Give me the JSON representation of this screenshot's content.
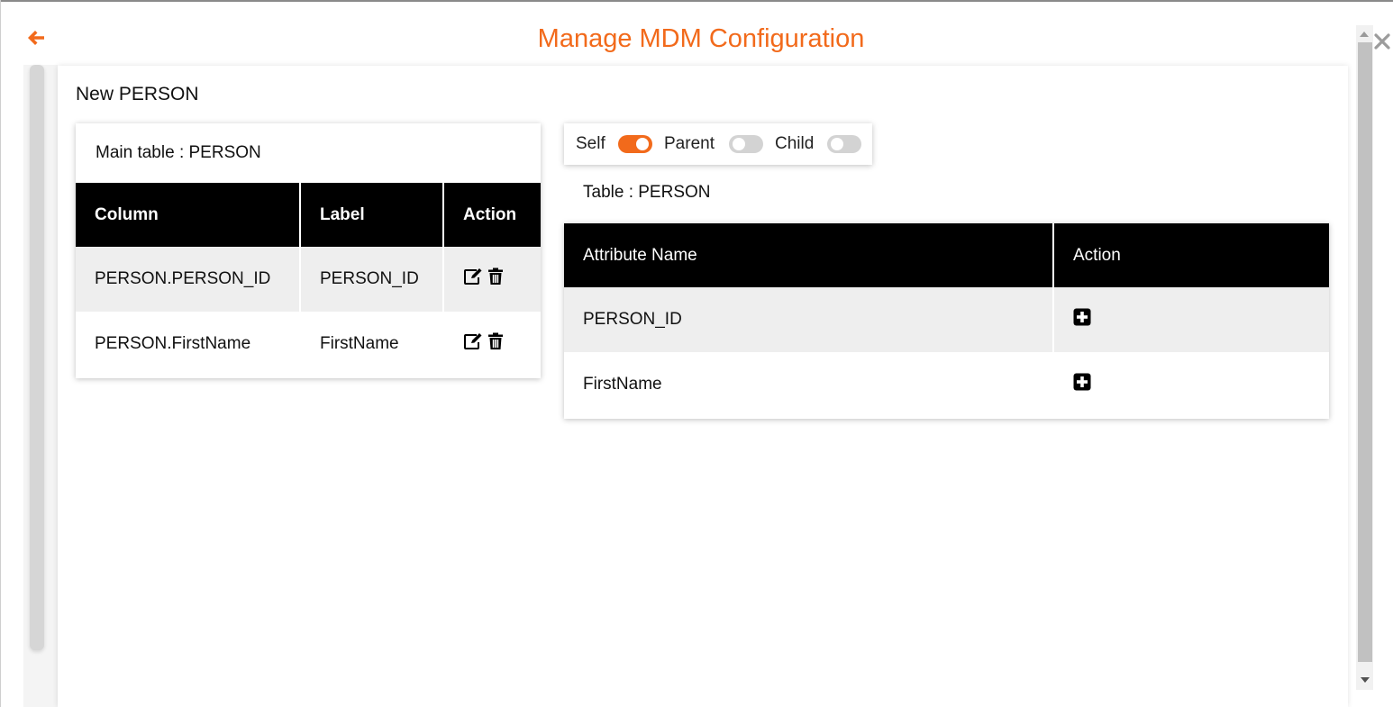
{
  "header": {
    "title": "Manage MDM Configuration",
    "back_icon": "arrow-left-icon",
    "close_icon": "close-icon",
    "accent_color": "#f26a1b"
  },
  "card": {
    "title": "New PERSON"
  },
  "main_table": {
    "label": "Main table : PERSON",
    "columns": [
      "Column",
      "Label",
      "Action"
    ],
    "rows": [
      {
        "column": "PERSON.PERSON_ID",
        "label": "PERSON_ID",
        "actions": [
          "edit-icon",
          "trash-icon"
        ]
      },
      {
        "column": "PERSON.FirstName",
        "label": "FirstName",
        "actions": [
          "edit-icon",
          "trash-icon"
        ]
      }
    ]
  },
  "toggles": [
    {
      "label": "Self",
      "on": true
    },
    {
      "label": "Parent",
      "on": false
    },
    {
      "label": "Child",
      "on": false
    }
  ],
  "attribute_table": {
    "label": "Table : PERSON",
    "columns": [
      "Attribute Name",
      "Action"
    ],
    "rows": [
      {
        "name": "PERSON_ID",
        "action": "plus-square-icon"
      },
      {
        "name": "FirstName",
        "action": "plus-square-icon"
      }
    ]
  }
}
